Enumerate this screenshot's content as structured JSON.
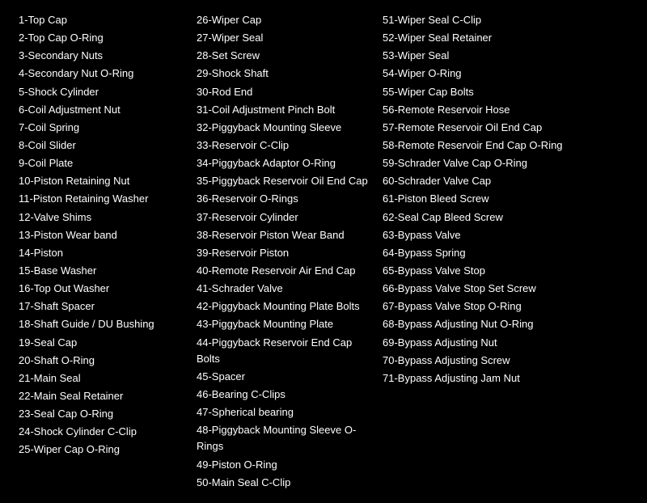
{
  "col1": [
    "1-Top Cap",
    "2-Top Cap O-Ring",
    "3-Secondary Nuts",
    "4-Secondary Nut O-Ring",
    "5-Shock Cylinder",
    "6-Coil Adjustment Nut",
    "7-Coil Spring",
    "8-Coil Slider",
    "9-Coil Plate",
    "10-Piston Retaining Nut",
    "11-Piston Retaining Washer",
    "12-Valve Shims",
    "13-Piston Wear band",
    "14-Piston",
    "15-Base Washer",
    "16-Top Out Washer",
    "17-Shaft Spacer",
    "18-Shaft Guide / DU Bushing",
    "19-Seal Cap",
    "20-Shaft O-Ring",
    "21-Main Seal",
    "22-Main Seal Retainer",
    "23-Seal Cap O-Ring",
    "24-Shock Cylinder C-Clip",
    "25-Wiper Cap O-Ring"
  ],
  "col2": [
    "26-Wiper Cap",
    "27-Wiper Seal",
    "28-Set Screw",
    "29-Shock Shaft",
    "30-Rod End",
    "31-Coil Adjustment Pinch Bolt",
    "32-Piggyback Mounting Sleeve",
    "33-Reservoir C-Clip",
    "34-Piggyback Adaptor O-Ring",
    "35-Piggyback Reservoir Oil End Cap",
    "36-Reservoir O-Rings",
    "37-Reservoir Cylinder",
    "38-Reservoir Piston Wear Band",
    "39-Reservoir Piston",
    "40-Remote Reservoir Air End Cap",
    "41-Schrader Valve",
    "42-Piggyback Mounting Plate Bolts",
    "43-Piggyback Mounting Plate",
    "44-Piggyback Reservoir End Cap Bolts",
    "45-Spacer",
    "46-Bearing C-Clips",
    "47-Spherical bearing",
    "48-Piggyback Mounting Sleeve O-Rings",
    "49-Piston O-Ring",
    "50-Main Seal C-Clip"
  ],
  "col3": [
    "51-Wiper Seal C-Clip",
    "52-Wiper Seal Retainer",
    "53-Wiper Seal",
    "54-Wiper O-Ring",
    "55-Wiper Cap Bolts",
    "56-Remote Reservoir Hose",
    "57-Remote Reservoir Oil End Cap",
    "58-Remote Reservoir End Cap O-Ring",
    "59-Schrader Valve Cap O-Ring",
    "60-Schrader Valve Cap",
    "61-Piston Bleed Screw",
    "62-Seal Cap Bleed Screw",
    "63-Bypass Valve",
    "64-Bypass Spring",
    "65-Bypass Valve Stop",
    "66-Bypass Valve Stop Set Screw",
    "67-Bypass Valve Stop O-Ring",
    "68-Bypass Adjusting Nut O-Ring",
    "69-Bypass Adjusting Nut",
    "70-Bypass Adjusting Screw",
    "71-Bypass Adjusting Jam Nut"
  ]
}
